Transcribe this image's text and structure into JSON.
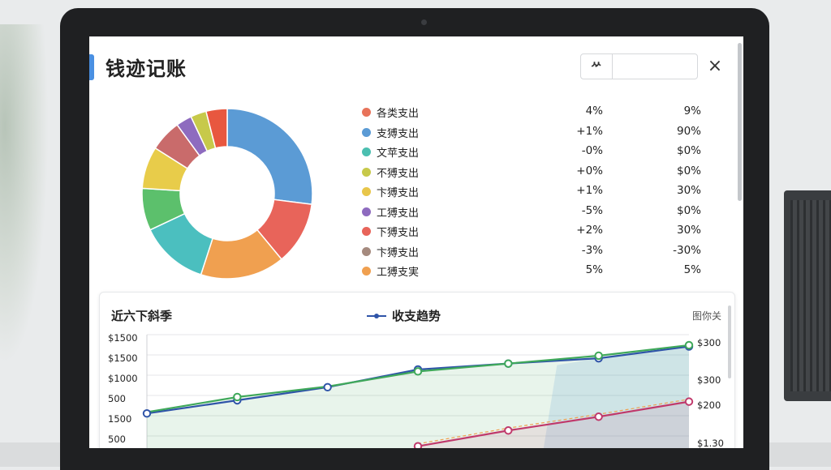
{
  "app": {
    "title": "钱迹记账"
  },
  "header": {
    "control_icon": "ᄽ",
    "control_value": "",
    "close_icon": "×"
  },
  "breakdown": {
    "items": [
      {
        "label": "各类支出",
        "value1": "4%",
        "value2": "9%",
        "color": "#e8735a"
      },
      {
        "label": "支猼支出",
        "value1": "+1%",
        "value2": "90%",
        "color": "#5b9bd5"
      },
      {
        "label": "文苹支出",
        "value1": "-0%",
        "value2": "$0%",
        "color": "#4bbfb0"
      },
      {
        "label": "不猼支出",
        "value1": "+0%",
        "value2": "$0%",
        "color": "#c7c94a"
      },
      {
        "label": "卞猼支出",
        "value1": "+1%",
        "value2": "30%",
        "color": "#e8c64a"
      },
      {
        "label": "工猼支出",
        "value1": "-5%",
        "value2": "$0%",
        "color": "#8e6bbf"
      },
      {
        "label": "下猼支出",
        "value1": "+2%",
        "value2": "30%",
        "color": "#e8645a"
      },
      {
        "label": "卞猼支出",
        "value1": "-3%",
        "value2": "-30%",
        "color": "#a58a7e"
      },
      {
        "label": "工猼支実",
        "value1": "5%",
        "value2": "5%",
        "color": "#f0a050"
      }
    ]
  },
  "donut": {
    "segments": [
      {
        "share": 0.27,
        "color": "#5b9bd5"
      },
      {
        "share": 0.12,
        "color": "#e8645a"
      },
      {
        "share": 0.16,
        "color": "#f0a050"
      },
      {
        "share": 0.13,
        "color": "#4bbfbf"
      },
      {
        "share": 0.08,
        "color": "#5cc06c"
      },
      {
        "share": 0.08,
        "color": "#e8cc4a"
      },
      {
        "share": 0.06,
        "color": "#c96b6b"
      },
      {
        "share": 0.03,
        "color": "#8e6bbf"
      },
      {
        "share": 0.03,
        "color": "#c7c94a"
      },
      {
        "share": 0.04,
        "color": "#e8573f"
      }
    ]
  },
  "trend": {
    "title": "近六下斜季",
    "legend_label": "收支趋势",
    "link": "图你关",
    "chart_data": {
      "type": "line",
      "x": [
        0,
        1,
        2,
        3,
        4,
        5,
        6
      ],
      "left_ticks": [
        "$1500",
        "$1500",
        "$1000",
        "500",
        "1500",
        "500"
      ],
      "right_ticks": [
        "$300",
        "$300",
        "$200",
        "$1.30"
      ],
      "ylim": [
        0,
        2000
      ],
      "series": [
        {
          "color": "#2f54a8",
          "values": [
            800,
            1000,
            1200,
            1470,
            1560,
            1640,
            1820
          ]
        },
        {
          "color": "#3fa85a",
          "values": [
            820,
            1050,
            1210,
            1440,
            1560,
            1680,
            1840
          ]
        },
        {
          "color": "#c0396b",
          "values": [
            null,
            null,
            null,
            300,
            540,
            750,
            980
          ]
        }
      ]
    }
  }
}
